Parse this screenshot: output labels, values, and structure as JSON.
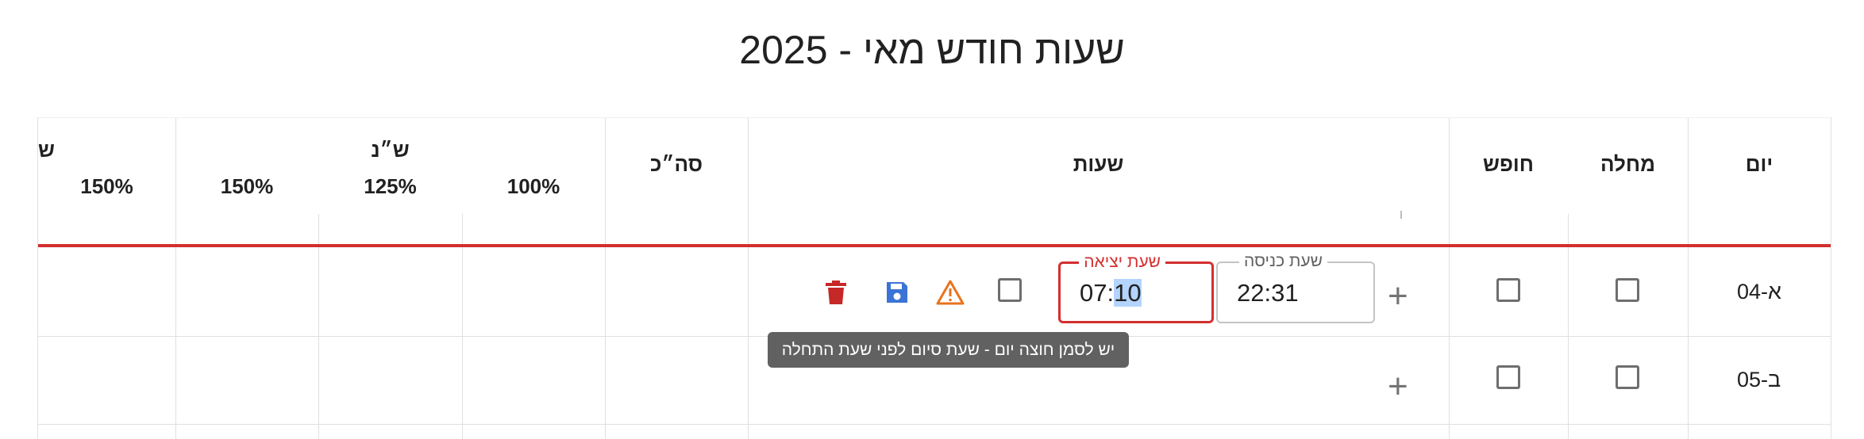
{
  "title": "שעות חודש מאי - 2025",
  "headers": {
    "day": "יום",
    "sick": "מחלה",
    "vacation": "חופש",
    "hours": "שעות",
    "total": "סה״כ",
    "shabbat_group": "ש״נ",
    "pct100": "100%",
    "pct125": "125%",
    "pct150a": "150%",
    "pct150b": "150%",
    "cut_group": "ש"
  },
  "rows": [
    {
      "day": "א-04",
      "entry_label": "שעת כניסה",
      "entry_value": "22:31",
      "exit_label": "שעת יציאה",
      "exit_value_prefix": "07:",
      "exit_value_selected": "10",
      "tooltip": "יש לסמן חוצה יום - שעת סיום לפני שעת התחלה"
    },
    {
      "day": "ב-05"
    }
  ],
  "plus_symbol": "+",
  "colors": {
    "error_red": "#d32f2f",
    "save_blue": "#3b73d6",
    "warning_orange": "#e8731c",
    "delete_red": "#c62828"
  },
  "icons": [
    "plus-icon",
    "warning-icon",
    "save-icon",
    "delete-icon"
  ]
}
